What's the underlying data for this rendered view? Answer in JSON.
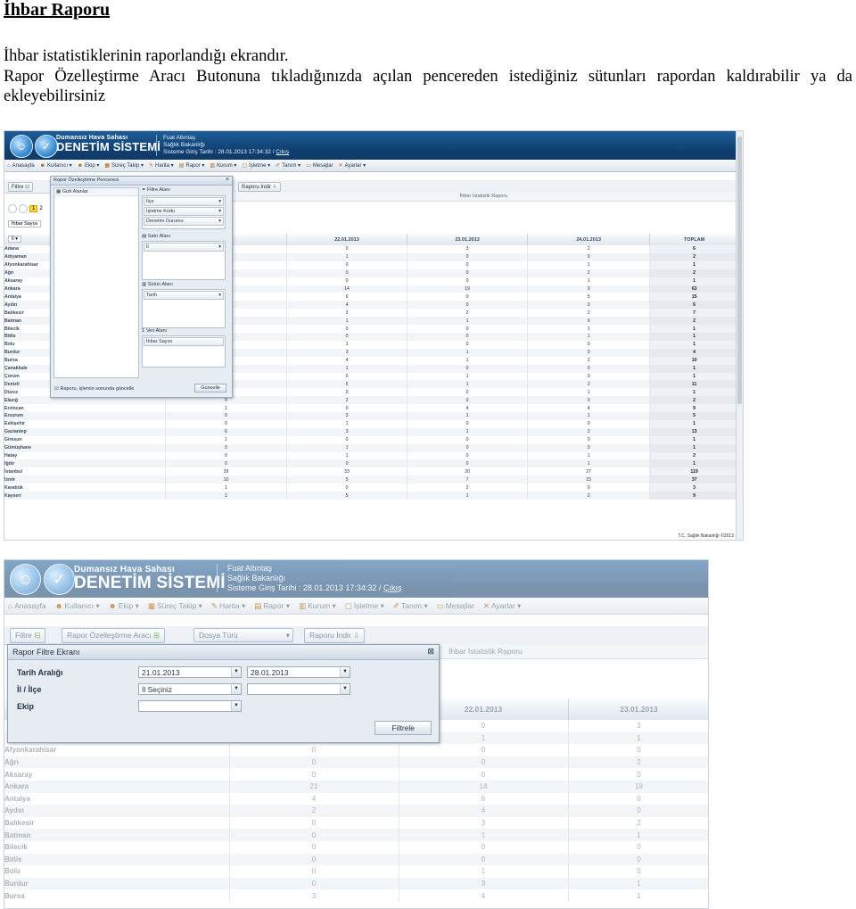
{
  "document": {
    "title": "İhbar Raporu",
    "para1": "İhbar istatistiklerinin raporlandığı ekrandır.",
    "para2": "Rapor Özelleştirme Aracı Butonuna tıkladığınızda açılan pencereden istediğiniz sütunları rapordan kaldırabilir ya da ekleyebilirsiniz"
  },
  "app": {
    "brand_sub": "Dumansız Hava Sahası",
    "brand_main": "DENETİM SİSTEMİ",
    "user_name": "Fuat Altıntaş",
    "user_org": "Sağlık Bakanlığı",
    "login_info": "Sisteme Giriş Tarihi : 28.01.2013 17:34:32 /",
    "logout": "Çıkış",
    "menu": [
      "Anasayfa",
      "Kullanıcı ▾",
      "Ekip ▾",
      "Süreç Takip ▾",
      "Harita ▾",
      "Rapor ▾",
      "Kurum ▾",
      "İşletme ▾",
      "Tanım ▾",
      "Mesajlar",
      "Ayarlar ▾"
    ],
    "footer_note": "T.C. Sağlık Bakanlığı ©2013"
  },
  "screenshot1": {
    "toolbar_filter": "Filtre",
    "toolbar_download": "Raporu İndir",
    "report_title": "İhbar İstatistik Raporu",
    "page_number": "1",
    "page_next": "2",
    "data_field_chip": "İhbar Sayısı",
    "row_dropdown": "İl ▾",
    "popup": {
      "title": "Rapor Özelleştirme Penceresi",
      "hidden_fields": "Gizli Alanlar",
      "filter_area": "Filtre Alanı",
      "filter_chips": [
        "İlçe",
        "İşletme Kodu",
        "Denetim Durumu"
      ],
      "row_area": "Satır Alanı",
      "row_chip": "İl",
      "column_area": "Sütun Alanı",
      "column_chip": "Tarih",
      "data_area": "Veri Alanı",
      "data_chip": "İhbar Sayısı",
      "checkbox_label": "Raporu, işlemin sonunda güncelle",
      "update_button": "Güncelle"
    },
    "columns": [
      "",
      "2013",
      "22.01.2013",
      "23.01.2013",
      "24.01.2013",
      "TOPLAM"
    ],
    "rows": [
      [
        "Adana",
        "",
        "0",
        "3",
        "2",
        "6"
      ],
      [
        "Adıyaman",
        "",
        "1",
        "0",
        "0",
        "2"
      ],
      [
        "Afyonkarahisar",
        "",
        "0",
        "0",
        "1",
        "1"
      ],
      [
        "Ağrı",
        "",
        "0",
        "0",
        "2",
        "2"
      ],
      [
        "Aksaray",
        "",
        "0",
        "0",
        "1",
        "1"
      ],
      [
        "Ankara",
        "",
        "14",
        "19",
        "9",
        "63"
      ],
      [
        "Antalya",
        "",
        "6",
        "0",
        "5",
        "15"
      ],
      [
        "Aydın",
        "",
        "4",
        "0",
        "0",
        "6"
      ],
      [
        "Balıkesir",
        "",
        "3",
        "2",
        "2",
        "7"
      ],
      [
        "Batman",
        "",
        "1",
        "1",
        "0",
        "2"
      ],
      [
        "Bilecik",
        "",
        "0",
        "0",
        "1",
        "1"
      ],
      [
        "Bitlis",
        "",
        "0",
        "0",
        "1",
        "1"
      ],
      [
        "Bolu",
        "",
        "1",
        "0",
        "0",
        "1"
      ],
      [
        "Burdur",
        "",
        "3",
        "1",
        "0",
        "4"
      ],
      [
        "Bursa",
        "",
        "4",
        "1",
        "2",
        "10"
      ],
      [
        "Çanakkale",
        "",
        "1",
        "0",
        "0",
        "1"
      ],
      [
        "Çorum",
        "",
        "0",
        "1",
        "0",
        "1"
      ],
      [
        "Denizli",
        "3",
        "5",
        "1",
        "2",
        "11"
      ],
      [
        "Düzce",
        "0",
        "0",
        "0",
        "1",
        "1"
      ],
      [
        "Elazığ",
        "0",
        "2",
        "0",
        "0",
        "2"
      ],
      [
        "Erzincan",
        "1",
        "0",
        "4",
        "4",
        "9"
      ],
      [
        "Erzurum",
        "0",
        "3",
        "1",
        "1",
        "5"
      ],
      [
        "Eskişehir",
        "0",
        "1",
        "0",
        "0",
        "1"
      ],
      [
        "Gaziantep",
        "6",
        "3",
        "1",
        "3",
        "13"
      ],
      [
        "Giresun",
        "1",
        "0",
        "0",
        "0",
        "1"
      ],
      [
        "Gümüşhane",
        "0",
        "1",
        "0",
        "0",
        "1"
      ],
      [
        "Hatay",
        "0",
        "1",
        "0",
        "1",
        "2"
      ],
      [
        "Iğdır",
        "0",
        "0",
        "0",
        "1",
        "1"
      ],
      [
        "İstanbul",
        "39",
        "33",
        "20",
        "27",
        "119"
      ],
      [
        "İzmir",
        "10",
        "5",
        "7",
        "15",
        "37"
      ],
      [
        "Karabük",
        "1",
        "0",
        "2",
        "0",
        "3"
      ],
      [
        "Kayseri",
        "1",
        "5",
        "1",
        "2",
        "9"
      ]
    ]
  },
  "screenshot2": {
    "toolbar_filter": "Filtre",
    "toolbar_customize": "Rapor Özelleştirme Aracı",
    "toolbar_file_type": "Dosya Türü",
    "toolbar_download": "Raporu İndir",
    "report_title": "İhbar İstatistik Raporu",
    "popup": {
      "title": "Rapor Filtre Ekranı",
      "date_label": "Tarih Aralığı",
      "date_from": "21.01.2013",
      "date_to": "28.01.2013",
      "province_label": "İl / İlçe",
      "province_value": "İl Seçiniz",
      "district_value": "",
      "team_label": "Ekip",
      "team_value": "",
      "filter_button": "Filtrele"
    },
    "columns": [
      "",
      "",
      "22.01.2013",
      "23.01.2013"
    ],
    "rows": [
      [
        "",
        "0",
        "0",
        "3"
      ],
      [
        "",
        "",
        "1",
        "1"
      ],
      [
        "Afyonkarahisar",
        "0",
        "0",
        "0"
      ],
      [
        "Ağrı",
        "0",
        "0",
        "2"
      ],
      [
        "Aksaray",
        "0",
        "0",
        "0"
      ],
      [
        "Ankara",
        "21",
        "14",
        "19"
      ],
      [
        "Antalya",
        "4",
        "6",
        "0"
      ],
      [
        "Aydın",
        "2",
        "4",
        "0"
      ],
      [
        "Balıkesir",
        "0",
        "3",
        "2"
      ],
      [
        "Batman",
        "0",
        "1",
        "1"
      ],
      [
        "Bilecik",
        "0",
        "0",
        "0"
      ],
      [
        "Bitlis",
        "0",
        "0",
        "0"
      ],
      [
        "Bolu",
        "0",
        "1",
        "0"
      ],
      [
        "Burdur",
        "0",
        "3",
        "1"
      ],
      [
        "Bursa",
        "3",
        "4",
        "1"
      ]
    ]
  }
}
